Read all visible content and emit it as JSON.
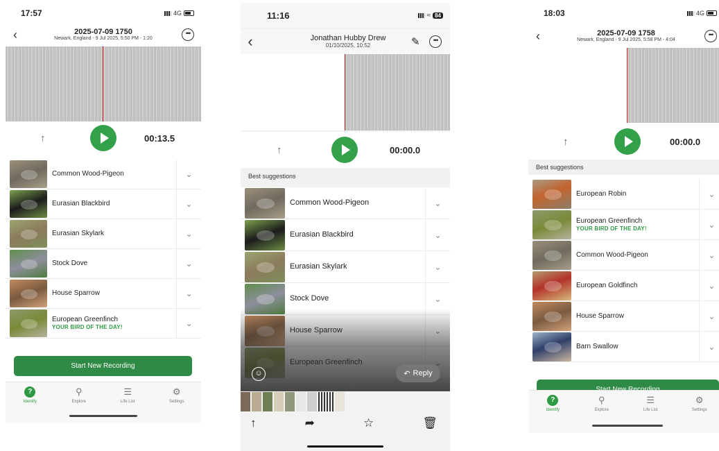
{
  "phone1": {
    "status": {
      "time": "17:57",
      "network": "4G"
    },
    "header": {
      "title": "2025-07-09 1750",
      "subtitle": "Newark, England - 9 Jul 2025, 5:50 PM - 1:20"
    },
    "player": {
      "time": "00:13.5"
    },
    "birds": [
      {
        "name": "Common Wood-Pigeon",
        "sub": ""
      },
      {
        "name": "Eurasian Blackbird",
        "sub": ""
      },
      {
        "name": "Eurasian Skylark",
        "sub": ""
      },
      {
        "name": "Stock Dove",
        "sub": ""
      },
      {
        "name": "House Sparrow",
        "sub": ""
      },
      {
        "name": "European Greenfinch",
        "sub": "YOUR BIRD OF THE DAY!"
      }
    ],
    "start_button": "Start New Recording",
    "tabs": [
      "Identify",
      "Explore",
      "Life List",
      "Settings"
    ]
  },
  "phone2": {
    "status": {
      "time": "11:16",
      "battery": "84"
    },
    "header": {
      "title": "Jonathan Hubby Drew",
      "subtitle": "01/10/2025, 10:52"
    },
    "player": {
      "time": "00:00.0"
    },
    "section": "Best suggestions",
    "birds": [
      {
        "name": "Common Wood-Pigeon"
      },
      {
        "name": "Eurasian Blackbird"
      },
      {
        "name": "Eurasian Skylark"
      },
      {
        "name": "Stock Dove"
      },
      {
        "name": "House Sparrow"
      },
      {
        "name": "European Greenfinch"
      }
    ],
    "reply": "Reply"
  },
  "phone3": {
    "status": {
      "time": "18:03",
      "network": "4G"
    },
    "header": {
      "title": "2025-07-09 1758",
      "subtitle": "Newark, England - 9 Jul 2025, 5:58 PM - 4:04"
    },
    "player": {
      "time": "00:00.0"
    },
    "section": "Best suggestions",
    "birds": [
      {
        "name": "European Robin",
        "sub": ""
      },
      {
        "name": "European Greenfinch",
        "sub": "YOUR BIRD OF THE DAY!"
      },
      {
        "name": "Common Wood-Pigeon",
        "sub": ""
      },
      {
        "name": "European Goldfinch",
        "sub": ""
      },
      {
        "name": "House Sparrow",
        "sub": ""
      },
      {
        "name": "Barn Swallow",
        "sub": ""
      }
    ],
    "start_button": "Start New Recording",
    "tabs": [
      "Identify",
      "Explore",
      "Life List",
      "Settings"
    ]
  },
  "colors": {
    "accent": "#33a04a",
    "button": "#2f8a45",
    "highlight_text": "#2e9a44"
  }
}
